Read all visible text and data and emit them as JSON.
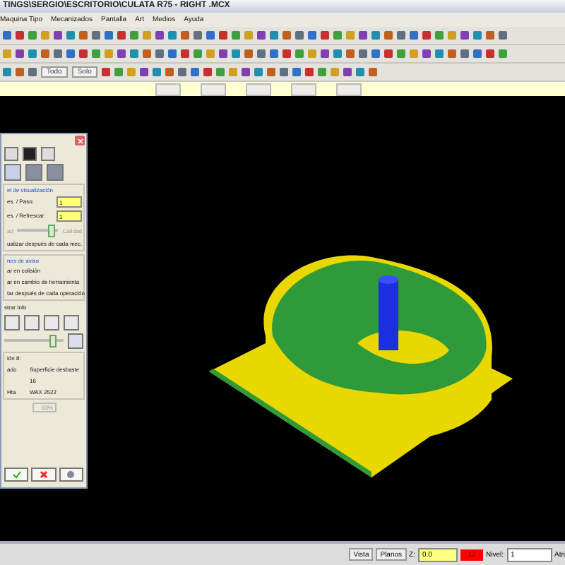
{
  "window": {
    "title": "TINGS\\SERGIO\\ESCRITORIO\\CULATA R75 - RIGHT .MCX"
  },
  "menu": [
    "Maquina Tipo",
    "Mecanizados",
    "Pantalla",
    "Art",
    "Medios",
    "Ayuda"
  ],
  "toolbar": {
    "buttons": [
      "Todo",
      "Solo"
    ]
  },
  "dialog": {
    "display_group": {
      "title": "el de visualización",
      "fields": [
        {
          "label": "es. / Paso:",
          "value": "1"
        },
        {
          "label": "es. / Refrescar:",
          "value": "1"
        }
      ],
      "slider": {
        "left": "ad",
        "right": "Calidad",
        "level": 0.9
      },
      "check": "ualizar después de cada mec."
    },
    "alerts_group": {
      "title": "nes de aviso",
      "checks": [
        "ar en colisión",
        "ar en cambio de herramienta",
        "tar después de cada operación"
      ]
    },
    "show_info": "strar Info",
    "speed": {
      "level": 0.88
    },
    "info": [
      {
        "label": "ión 8:"
      },
      {
        "label": "ado",
        "value": "Superficie desbaste"
      },
      {
        "value": "16"
      },
      {
        "label": "Hta",
        "value": "WAX 2522"
      }
    ],
    "progress": "63%"
  },
  "status_bar": {
    "buttons": [
      "Vista",
      "Planos"
    ],
    "z_label": "Z:",
    "z_value": "0.0",
    "color": {
      "label": "12",
      "color": "#ff0000"
    },
    "level_label": "Nivel:",
    "level_value": "1",
    "cut": "Atri"
  }
}
